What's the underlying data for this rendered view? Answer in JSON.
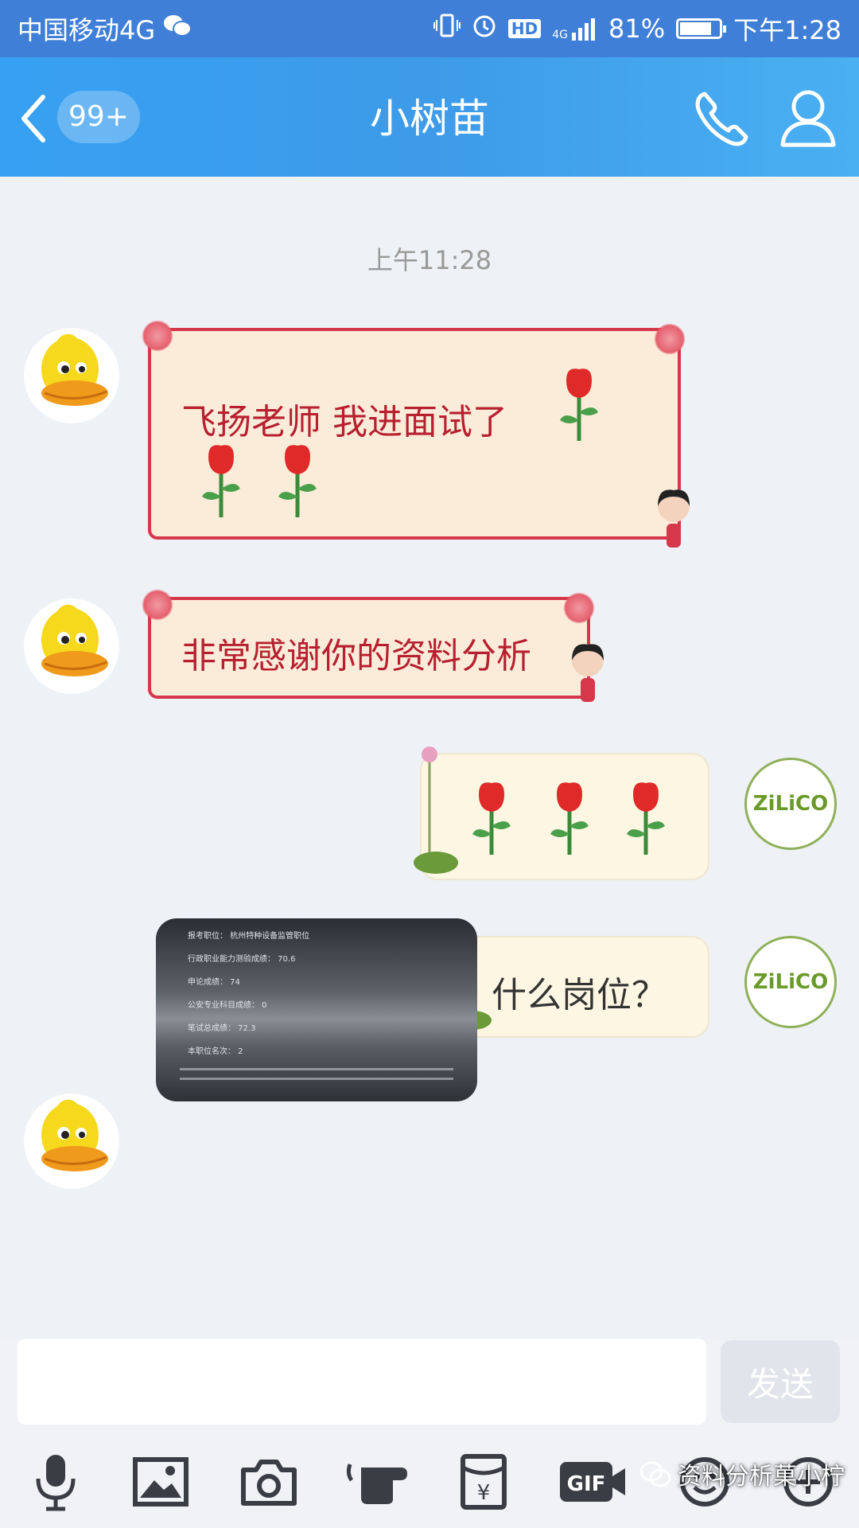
{
  "status_bar": {
    "carrier": "中国移动4G",
    "net_label": "4G",
    "hd": "HD",
    "battery": "81%",
    "battery_level": 0.81,
    "time": "下午1:28"
  },
  "header": {
    "unread_badge": "99+",
    "title": "小树苗"
  },
  "chat": {
    "timestamp": "上午11:28",
    "messages": [
      {
        "side": "left",
        "text_line1": "飞扬老师 我进面试了"
      },
      {
        "side": "left",
        "text": "非常感谢你的资料分析"
      },
      {
        "side": "right",
        "content": "rose-emojis"
      },
      {
        "side": "right",
        "text": "什么岗位？"
      },
      {
        "side": "left",
        "content": "photo"
      }
    ],
    "right_avatar_label": "ZiLiCO",
    "photo_rows": [
      "报考职位：   杭州特种设备监管职位",
      "行政职业能力测验成绩：   70.6",
      "申论成绩：   74",
      "公安专业科目成绩：   0",
      "笔试总成绩：   72.3",
      "本职位名次：   2"
    ]
  },
  "composer": {
    "input_value": "",
    "send_label": "发送"
  },
  "toolbar": {
    "icons": [
      "microphone-icon",
      "image-icon",
      "camera-icon",
      "hand-icon",
      "red-packet-icon",
      "gif-icon",
      "emoji-icon",
      "plus-icon"
    ],
    "gif_label": "GIF",
    "yen_label": "¥"
  },
  "watermark": {
    "text": "资料分析菓小柠"
  },
  "colors": {
    "header_blue": "#3d9be9",
    "red_bubble_border": "#d5384b",
    "red_text": "#b72030"
  }
}
